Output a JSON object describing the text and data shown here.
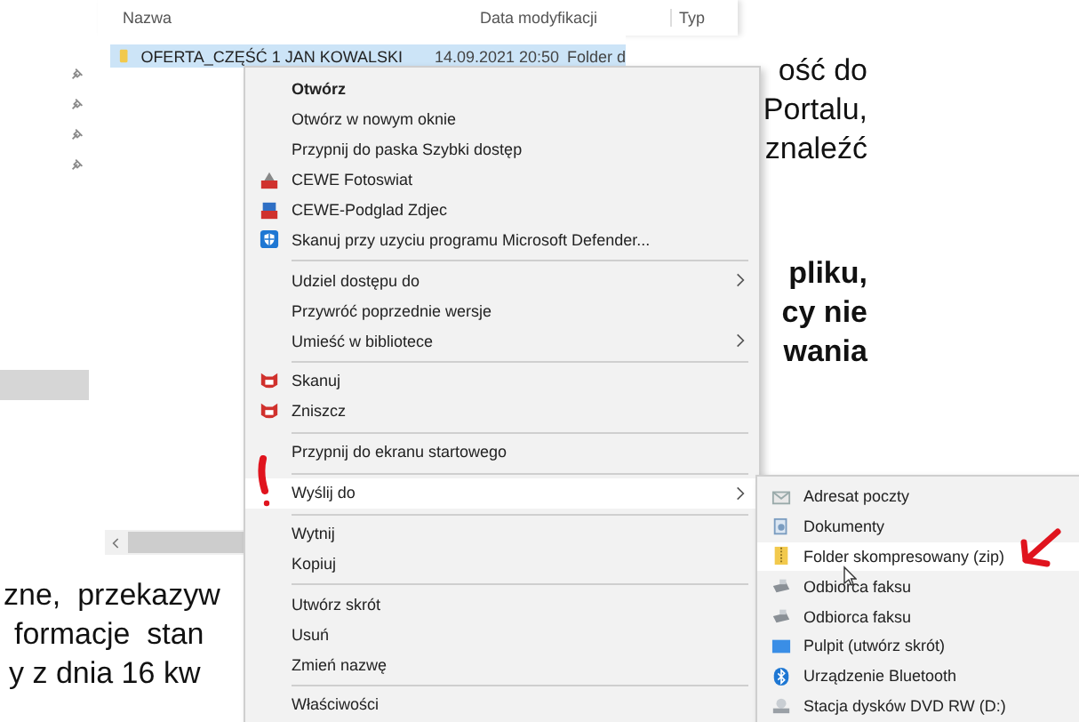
{
  "document": {
    "top_lines": [
      "ość do",
      "Portalu,",
      "znaleźć"
    ],
    "bold_lines": [
      "pliku,",
      "cy nie",
      "wania"
    ],
    "bottom_lines": [
      "zne,  przekazyw",
      "formacje  stan",
      "y z dnia 16 kw"
    ]
  },
  "explorer": {
    "columns": [
      "Nazwa",
      "Data modyfikacji",
      "Typ"
    ],
    "rows": [
      {
        "name": "OFERTA_CZĘŚĆ 1 JAN KOWALSKI",
        "modified": "14.09.2021 20:50",
        "type": "Folder d",
        "selected": true
      }
    ]
  },
  "context_menu": {
    "items": [
      {
        "kind": "plain",
        "label": "Otwórz",
        "bold": true,
        "submenu": false,
        "selected": false
      },
      {
        "kind": "plain",
        "label": "Otwórz w nowym oknie",
        "bold": false,
        "submenu": false,
        "selected": false
      },
      {
        "kind": "plain",
        "label": "Przypnij do paska Szybki dostęp",
        "bold": false,
        "submenu": false,
        "selected": false
      },
      {
        "kind": "cewe_photo",
        "label": "CEWE Fotoswiat",
        "bold": false,
        "submenu": false,
        "selected": false
      },
      {
        "kind": "cewe_viewer",
        "label": "CEWE-Podglad Zdjec",
        "bold": false,
        "submenu": false,
        "selected": false
      },
      {
        "kind": "defender",
        "label": "Skanuj przy uzyciu programu Microsoft Defender...",
        "bold": false,
        "submenu": false,
        "selected": false
      },
      {
        "kind": "separator"
      },
      {
        "kind": "plain",
        "label": "Udziel dostępu do",
        "bold": false,
        "submenu": true,
        "selected": false
      },
      {
        "kind": "plain",
        "label": "Przywróć poprzednie wersje",
        "bold": false,
        "submenu": false,
        "selected": false
      },
      {
        "kind": "plain",
        "label": "Umieść w bibliotece",
        "bold": false,
        "submenu": true,
        "selected": false
      },
      {
        "kind": "separator"
      },
      {
        "kind": "antivirus",
        "label": "Skanuj",
        "bold": false,
        "submenu": false,
        "selected": false
      },
      {
        "kind": "antivirus",
        "label": "Zniszcz",
        "bold": false,
        "submenu": false,
        "selected": false
      },
      {
        "kind": "separator"
      },
      {
        "kind": "plain",
        "label": "Przypnij do ekranu startowego",
        "bold": false,
        "submenu": false,
        "selected": false
      },
      {
        "kind": "separator"
      },
      {
        "kind": "plain",
        "label": "Wyślij do",
        "bold": false,
        "submenu": true,
        "selected": true
      },
      {
        "kind": "separator"
      },
      {
        "kind": "plain",
        "label": "Wytnij",
        "bold": false,
        "submenu": false,
        "selected": false
      },
      {
        "kind": "plain",
        "label": "Kopiuj",
        "bold": false,
        "submenu": false,
        "selected": false
      },
      {
        "kind": "separator"
      },
      {
        "kind": "plain",
        "label": "Utwórz skrót",
        "bold": false,
        "submenu": false,
        "selected": false
      },
      {
        "kind": "plain",
        "label": "Usuń",
        "bold": false,
        "submenu": false,
        "selected": false
      },
      {
        "kind": "plain",
        "label": "Zmień nazwę",
        "bold": false,
        "submenu": false,
        "selected": false
      },
      {
        "kind": "separator"
      },
      {
        "kind": "plain",
        "label": "Właściwości",
        "bold": false,
        "submenu": false,
        "selected": false
      }
    ]
  },
  "send_to_menu": {
    "items": [
      {
        "kind": "mail",
        "label": "Adresat poczty",
        "selected": false
      },
      {
        "kind": "documents",
        "label": "Dokumenty",
        "selected": false
      },
      {
        "kind": "zip",
        "label": "Folder skompresowany (zip)",
        "selected": true
      },
      {
        "kind": "fax",
        "label": "Odbiorca faksu",
        "selected": false
      },
      {
        "kind": "fax",
        "label": "Odbiorca faksu",
        "selected": false
      },
      {
        "kind": "desktop",
        "label": "Pulpit (utwórz skrót)",
        "selected": false
      },
      {
        "kind": "bluetooth",
        "label": "Urządzenie Bluetooth",
        "selected": false
      },
      {
        "kind": "drive",
        "label": "Stacja dysków DVD RW (D:)",
        "selected": false
      }
    ]
  }
}
